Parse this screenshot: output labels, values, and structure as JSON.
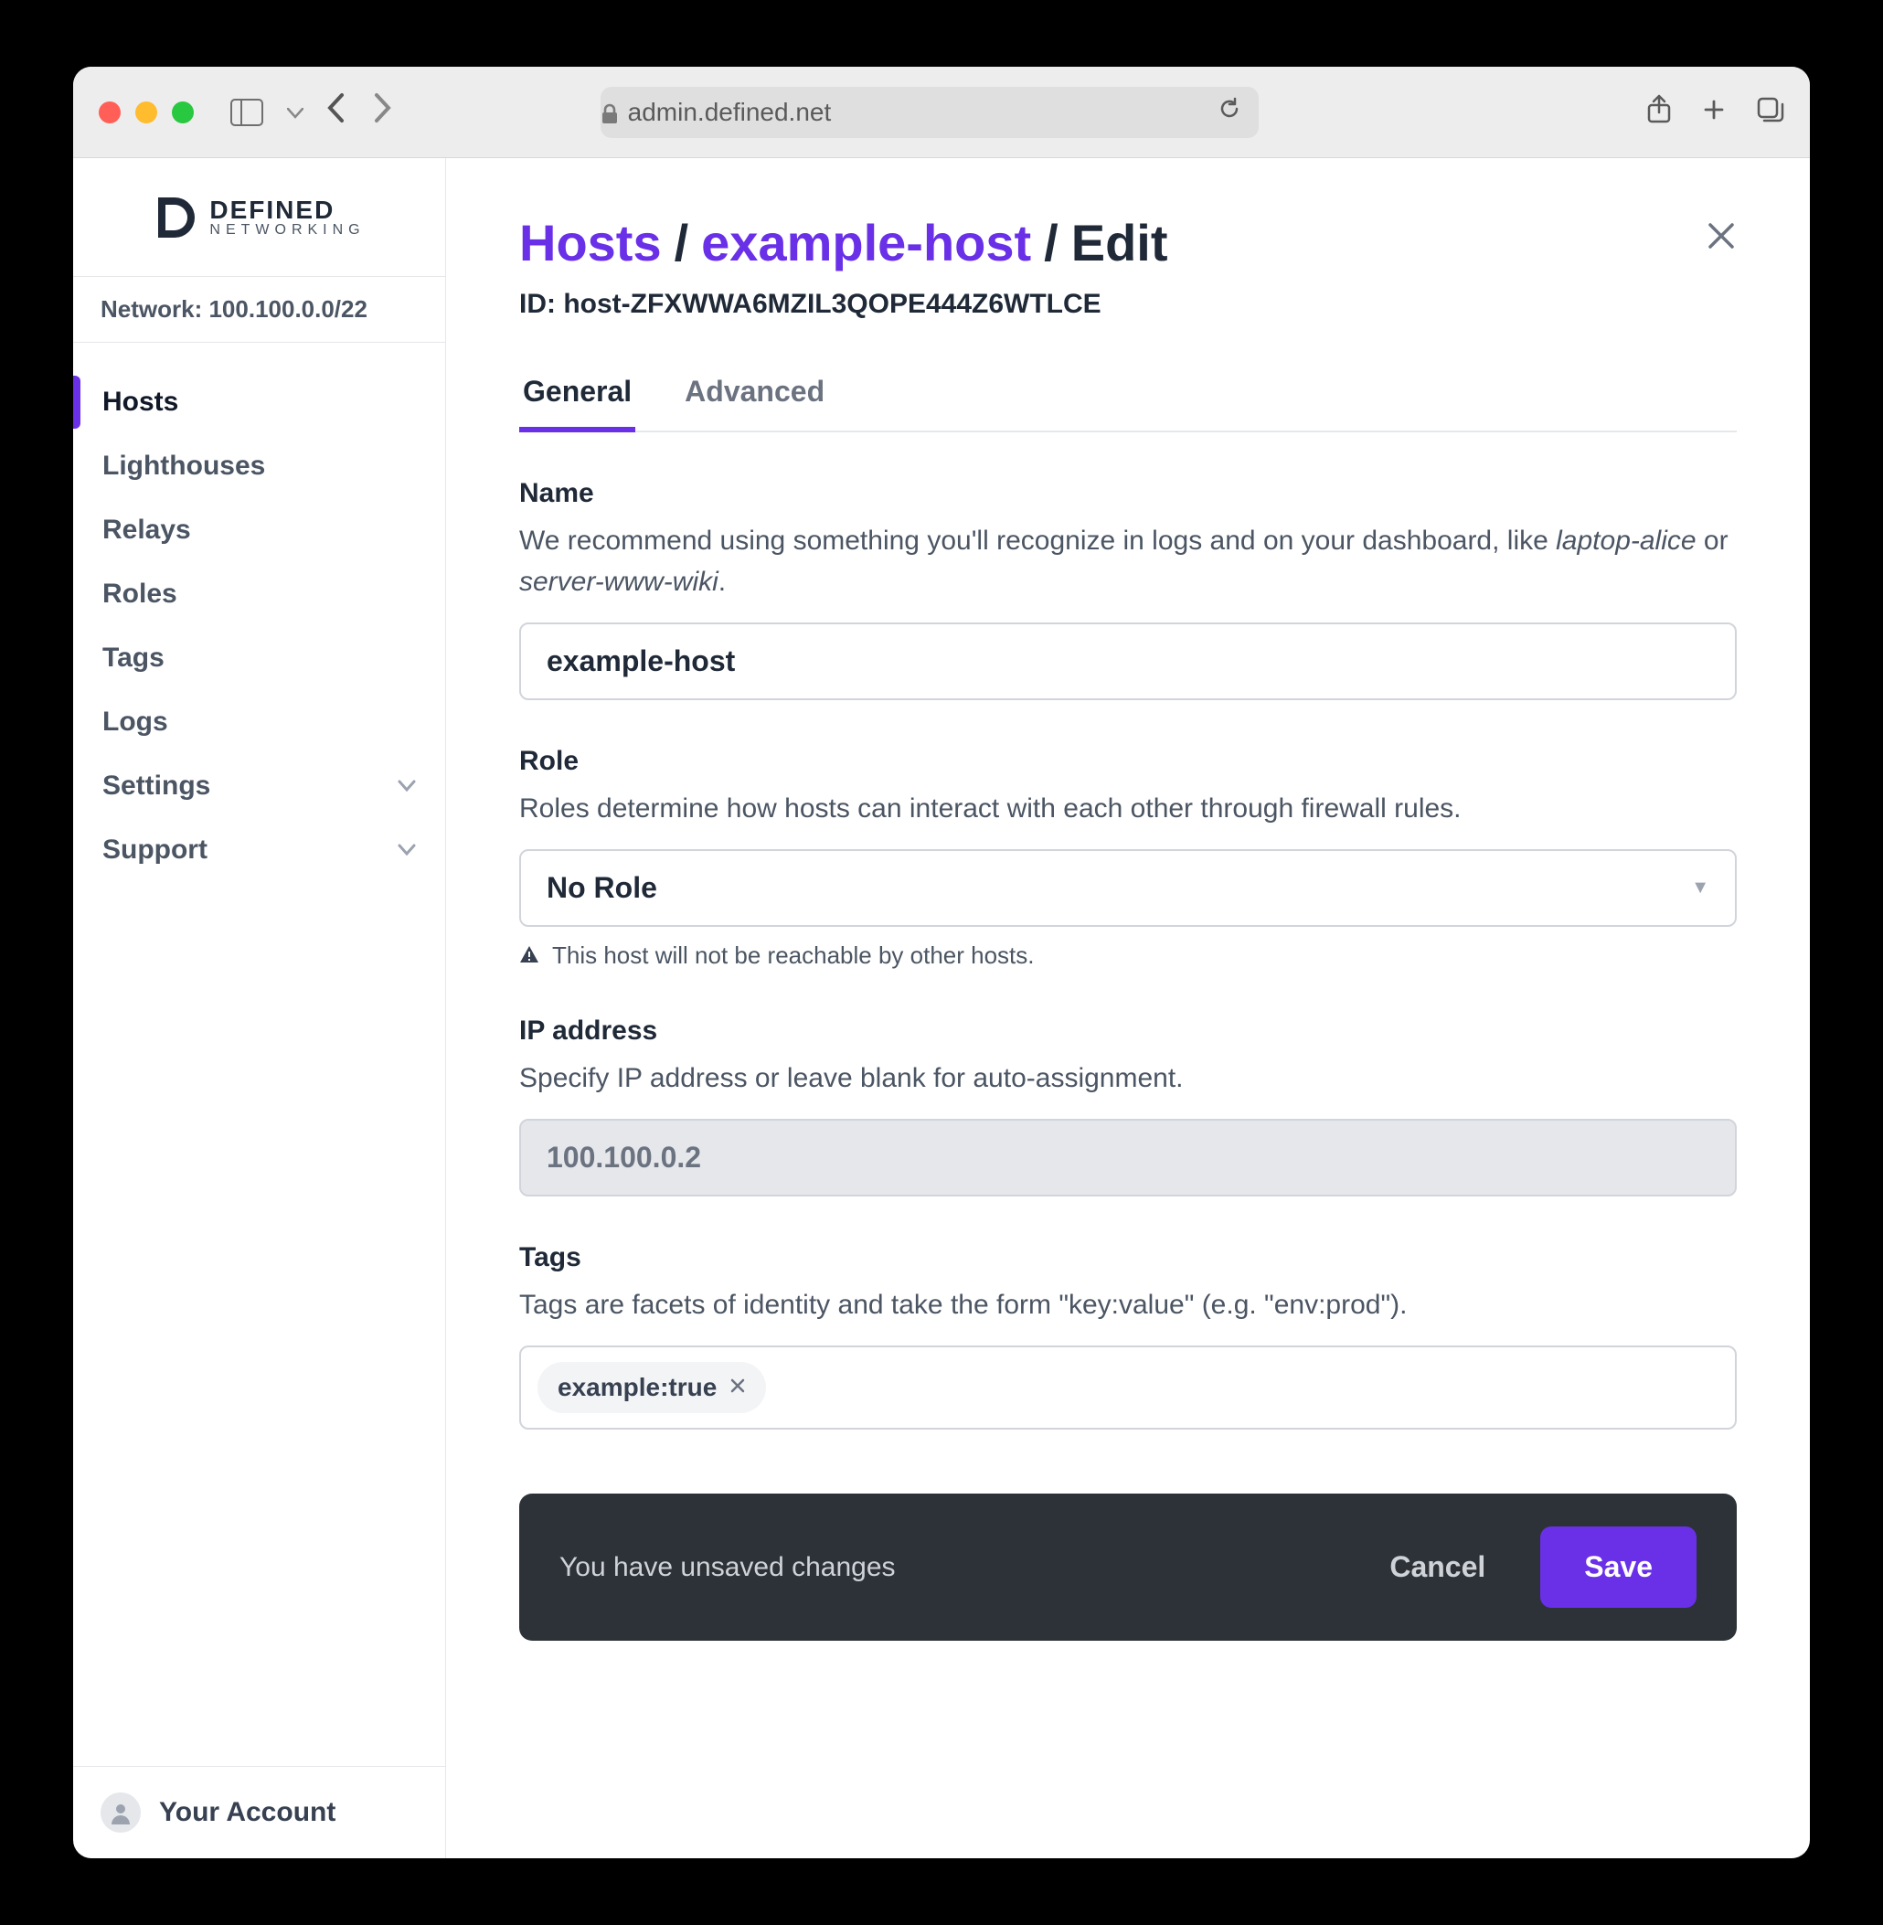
{
  "browser": {
    "address": "admin.defined.net"
  },
  "logo": {
    "line1": "DEFINED",
    "line2": "NETWORKING"
  },
  "network_label": "Network: 100.100.0.0/22",
  "sidebar": {
    "items": [
      {
        "label": "Hosts",
        "active": true
      },
      {
        "label": "Lighthouses"
      },
      {
        "label": "Relays"
      },
      {
        "label": "Roles"
      },
      {
        "label": "Tags"
      },
      {
        "label": "Logs"
      },
      {
        "label": "Settings",
        "chevron": true
      },
      {
        "label": "Support",
        "chevron": true
      }
    ],
    "account_label": "Your Account"
  },
  "breadcrumb": {
    "root": "Hosts",
    "sep": "/",
    "host": "example-host",
    "leaf": "Edit"
  },
  "host_id_label": "ID: host-ZFXWWA6MZIL3QOPE444Z6WTLCE",
  "tabs": {
    "general": "General",
    "advanced": "Advanced"
  },
  "fields": {
    "name": {
      "label": "Name",
      "help_pre": "We recommend using something you'll recognize in logs and on your dashboard, like ",
      "help_em1": "laptop-alice",
      "help_mid": " or ",
      "help_em2": "server-www-wiki",
      "help_post": ".",
      "value": "example-host"
    },
    "role": {
      "label": "Role",
      "help": "Roles determine how hosts can interact with each other through firewall rules.",
      "value": "No Role",
      "warning": "This host will not be reachable by other hosts."
    },
    "ip": {
      "label": "IP address",
      "help": "Specify IP address or leave blank for auto-assignment.",
      "value": "100.100.0.2"
    },
    "tags": {
      "label": "Tags",
      "help": "Tags are facets of identity and take the form \"key:value\" (e.g. \"env:prod\").",
      "items": [
        "example:true"
      ]
    }
  },
  "save_bar": {
    "message": "You have unsaved changes",
    "cancel": "Cancel",
    "save": "Save"
  }
}
